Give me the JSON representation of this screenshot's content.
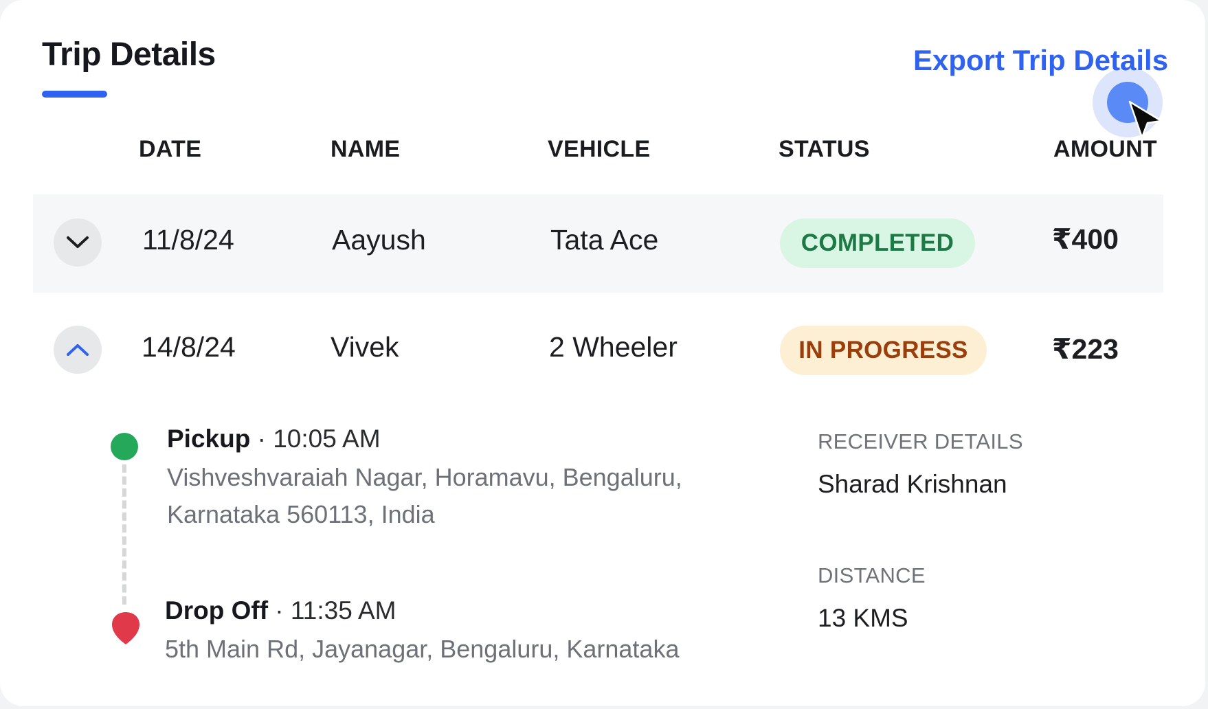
{
  "header": {
    "tab_title": "Trip Details",
    "export_label": "Export Trip Details"
  },
  "table": {
    "columns": [
      "DATE",
      "NAME",
      "VEHICLE",
      "STATUS",
      "AMOUNT"
    ],
    "rows": [
      {
        "date": "11/8/24",
        "name": "Aayush",
        "vehicle": "Tata Ace",
        "status": "COMPLETED",
        "amount": "₹400",
        "expanded": false
      },
      {
        "date": "14/8/24",
        "name": "Vivek",
        "vehicle": "2 Wheeler",
        "status": "IN PROGRESS",
        "amount": "₹223",
        "expanded": true
      }
    ]
  },
  "trip_detail": {
    "pickup": {
      "label": "Pickup",
      "time": "10:05 AM",
      "address_line1": "Vishveshvaraiah Nagar, Horamavu, Bengaluru,",
      "address_line2": "Karnataka 560113, India"
    },
    "dropoff": {
      "label": "Drop Off",
      "time": "11:35 AM",
      "address": "5th Main Rd, Jayanagar, Bengaluru, Karnataka"
    },
    "receiver": {
      "label": "RECEIVER DETAILS",
      "value": "Sharad Krishnan"
    },
    "distance": {
      "label": "DISTANCE",
      "value": "13 KMS"
    }
  },
  "colors": {
    "accent": "#2f62ef",
    "completed_bg": "#d9f5e4",
    "completed_text": "#1b7a45",
    "in_progress_bg": "#fdefd3",
    "in_progress_text": "#9a3f0c",
    "pickup_marker": "#24a85a",
    "dropoff_marker": "#e0394a"
  },
  "icons": {
    "row1_toggle": "chevron-down-icon",
    "row2_toggle": "chevron-up-icon",
    "pickup": "pickup-dot-icon",
    "dropoff": "location-pin-icon"
  }
}
